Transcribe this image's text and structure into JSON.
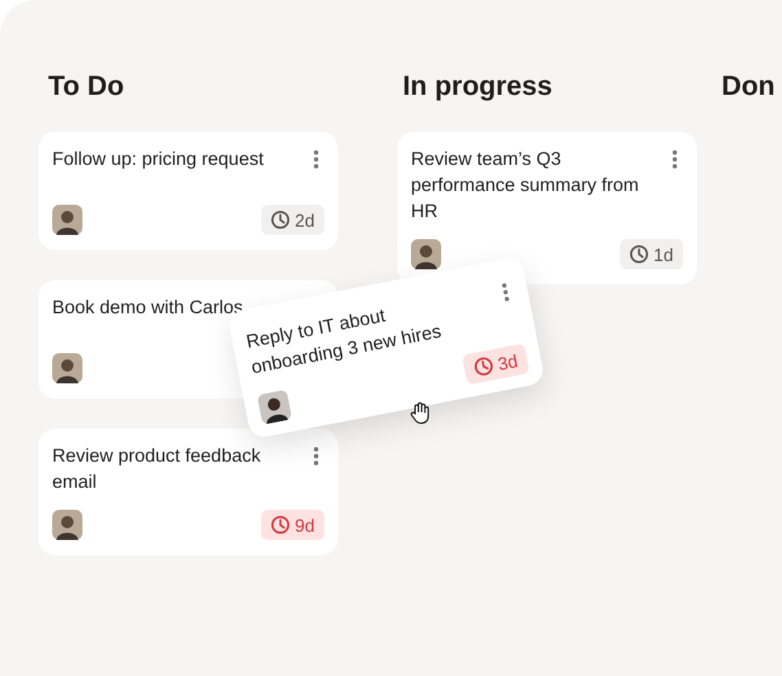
{
  "columns": [
    {
      "title": "To Do",
      "cards": [
        {
          "title": "Follow up: pricing request",
          "due": {
            "label": "2d",
            "overdue": false
          }
        },
        {
          "title": "Book demo with Carlos"
        },
        {
          "title": "Review product feedback email",
          "due": {
            "label": "9d",
            "overdue": true
          }
        }
      ]
    },
    {
      "title": "In progress",
      "cards": [
        {
          "title": "Review team’s Q3 performance summary from HR",
          "due": {
            "label": "1d",
            "overdue": false
          }
        }
      ]
    },
    {
      "title": "Don"
    }
  ],
  "dragged_card": {
    "title": "Reply to IT about onboarding 3 new hires",
    "due": {
      "label": "3d",
      "overdue": true
    }
  }
}
